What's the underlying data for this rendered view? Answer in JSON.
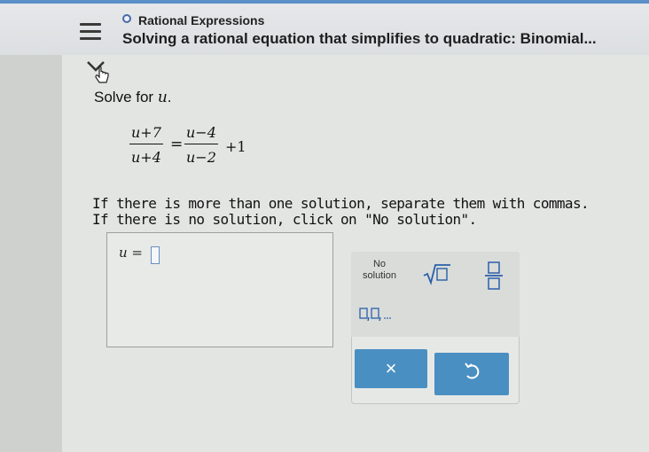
{
  "header": {
    "topic": "Rational Expressions",
    "subtitle": "Solving a rational equation that simplifies to quadratic: Binomial..."
  },
  "problem": {
    "prompt_prefix": "Solve for",
    "variable": "u",
    "prompt_suffix": ".",
    "equation": {
      "left_num": "u+7",
      "left_den": "u+4",
      "equals": "=",
      "right_num": "u−4",
      "right_den": "u−2",
      "plus_term": "+1"
    },
    "instructions": [
      "If there is more than one solution, separate them with commas.",
      "If there is no solution, click on \"No solution\"."
    ]
  },
  "answer": {
    "label": "u =",
    "value": ""
  },
  "keypad": {
    "no_solution_line1": "No",
    "no_solution_line2": "solution",
    "sqrt_icon": "square-root-icon",
    "fraction_icon": "fraction-icon",
    "list_icon": "comma-list-icon",
    "clear_label": "×",
    "undo_icon": "undo-icon"
  },
  "colors": {
    "accent": "#4a8fc2",
    "header_line": "#5a8fc8"
  }
}
